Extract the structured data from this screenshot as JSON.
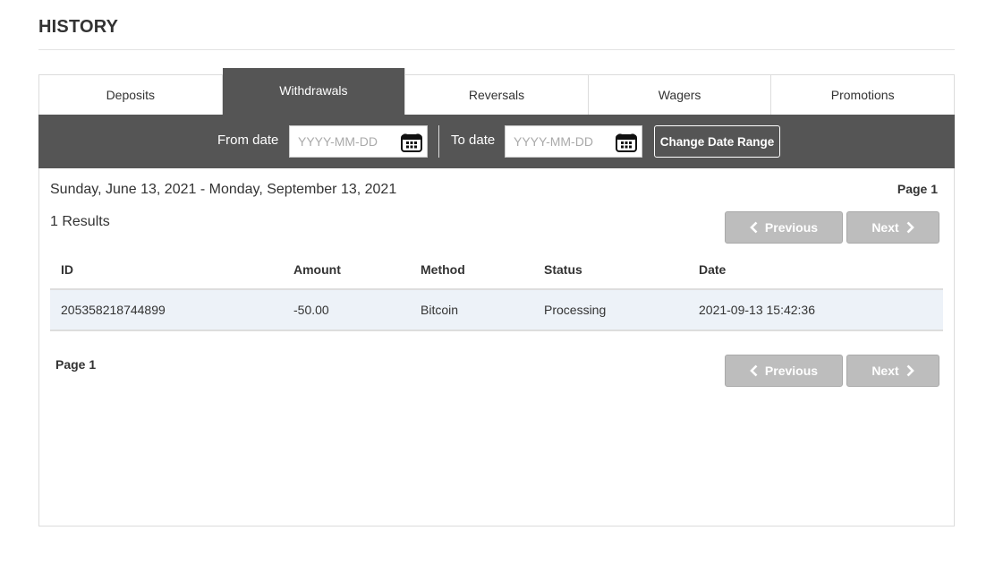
{
  "page": {
    "title": "HISTORY"
  },
  "tabs": [
    {
      "label": "Deposits",
      "active": false
    },
    {
      "label": "Withdrawals",
      "active": true
    },
    {
      "label": "Reversals",
      "active": false
    },
    {
      "label": "Wagers",
      "active": false
    },
    {
      "label": "Promotions",
      "active": false
    }
  ],
  "filters": {
    "from_label": "From date",
    "from_value": "",
    "from_placeholder": "YYYY-MM-DD",
    "to_label": "To date",
    "to_value": "",
    "to_placeholder": "YYYY-MM-DD",
    "change_button": "Change Date Range",
    "icon": "calendar-icon"
  },
  "summary": {
    "range": "Sunday, June 13, 2021 - Monday, September 13, 2021",
    "page_label": "Page 1",
    "results": "1 Results"
  },
  "pagination": {
    "previous_label": "Previous",
    "next_label": "Next",
    "bottom_page_label": "Page 1"
  },
  "table": {
    "columns": [
      "ID",
      "Amount",
      "Method",
      "Status",
      "Date"
    ],
    "rows": [
      [
        "205358218744899",
        "-50.00",
        "Bitcoin",
        "Processing",
        "2021-09-13 15:42:36"
      ]
    ]
  },
  "colors": {
    "bar_background": "#555555",
    "row_highlight": "#edf2f8",
    "disabled_button": "#bdbdbd"
  }
}
